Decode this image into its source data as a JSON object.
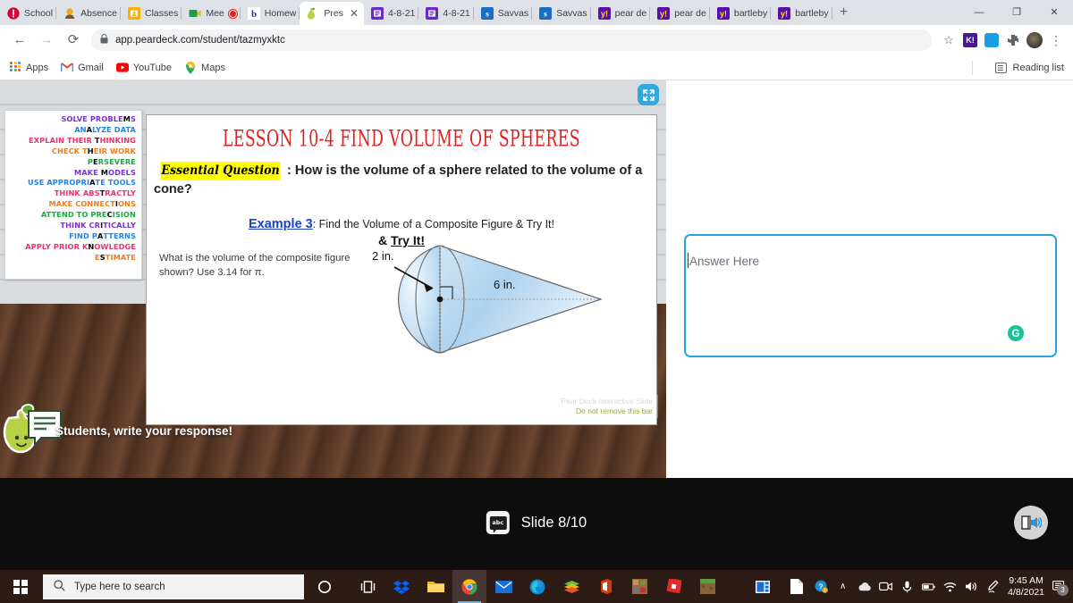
{
  "browser": {
    "tabs": [
      {
        "label": "School",
        "icon": "school-icon",
        "color": "#e8003c",
        "active": false
      },
      {
        "label": "Absence",
        "icon": "absence-icon",
        "color": "#f5a623",
        "active": false
      },
      {
        "label": "Classes",
        "icon": "classes-icon",
        "color": "#f5b300",
        "active": false
      },
      {
        "label": "Mee",
        "icon": "meet-icon",
        "color": "#1a9e4b",
        "active": false
      },
      {
        "label": "Homew",
        "icon": "bartleby-icon",
        "color": "#ffffff",
        "active": false
      },
      {
        "label": "Pres",
        "icon": "peardeck-icon",
        "color": "#ffffff",
        "active": true
      },
      {
        "label": "4-8-21",
        "icon": "slides-icon",
        "color": "#6a29c9",
        "active": false
      },
      {
        "label": "4-8-21",
        "icon": "slides-icon",
        "color": "#6a29c9",
        "active": false
      },
      {
        "label": "Savvas",
        "icon": "savvas-icon",
        "color": "#1a6fc4",
        "active": false
      },
      {
        "label": "Savvas",
        "icon": "savvas-icon",
        "color": "#1a6fc4",
        "active": false
      },
      {
        "label": "pear de",
        "icon": "pear-yellow-icon",
        "color": "#5a10a8",
        "active": false
      },
      {
        "label": "pear de",
        "icon": "pear-yellow-icon",
        "color": "#5a10a8",
        "active": false
      },
      {
        "label": "bartleby",
        "icon": "pear-yellow-icon",
        "color": "#5a10a8",
        "active": false
      },
      {
        "label": "bartleby",
        "icon": "pear-yellow-icon",
        "color": "#5a10a8",
        "active": false
      }
    ],
    "new_tab_label": "+",
    "close_tab_label": "✕",
    "window": {
      "minimize": "—",
      "maximize": "❐",
      "close": "✕"
    },
    "nav": {
      "back": "←",
      "forward": "→",
      "reload": "⟳"
    },
    "url": "app.peardeck.com/student/tazmyxktc",
    "lock_label": "🔒",
    "star_label": "☆",
    "extensions": [
      {
        "name": "kahoot-extension",
        "label": "K!"
      },
      {
        "name": "blue-extension",
        "label": ""
      },
      {
        "name": "puzzle-extension",
        "label": "🧩"
      }
    ],
    "menu_label": "⋮",
    "bookmarks": [
      {
        "label": "Apps",
        "icon": "apps-grid-icon"
      },
      {
        "label": "Gmail",
        "icon": "gmail-icon"
      },
      {
        "label": "YouTube",
        "icon": "youtube-icon"
      },
      {
        "label": "Maps",
        "icon": "maps-pin-icon"
      }
    ],
    "reading_list": "Reading list"
  },
  "poster": {
    "title": "MATHEMATICIANS",
    "lines": [
      {
        "pre": "SOLVE PROBLE",
        "letter": "M",
        "post": "S",
        "color": "#7b2fd6"
      },
      {
        "pre": "AN",
        "letter": "A",
        "post": "LYZE DATA",
        "color": "#1f84e8"
      },
      {
        "pre": "EXPLAIN THEIR ",
        "letter": "T",
        "post": "HINKING",
        "color": "#e8326b"
      },
      {
        "pre": "CHECK T",
        "letter": "H",
        "post": "EIR WORK",
        "color": "#f07d1a"
      },
      {
        "pre": "P",
        "letter": "E",
        "post": "RSEVERE",
        "color": "#19a844"
      },
      {
        "pre": "MAKE ",
        "letter": "M",
        "post": "ODELS",
        "color": "#7b2fd6"
      },
      {
        "pre": "USE APPROPRI",
        "letter": "A",
        "post": "TE TOOLS",
        "color": "#1f84e8"
      },
      {
        "pre": "THINK ABS",
        "letter": "T",
        "post": "RACTLY",
        "color": "#e8326b"
      },
      {
        "pre": "MAKE CONNECT",
        "letter": "I",
        "post": "ONS",
        "color": "#f07d1a"
      },
      {
        "pre": "ATTEND TO PRE",
        "letter": "C",
        "post": "ISION",
        "color": "#19a844"
      },
      {
        "pre": "THINK CR",
        "letter": "I",
        "post": "TICALLY",
        "color": "#7b2fd6"
      },
      {
        "pre": "FIND P",
        "letter": "A",
        "post": "TTERNS",
        "color": "#1f84e8"
      },
      {
        "pre": "APPLY PRIOR K",
        "letter": "N",
        "post": "OWLEDGE",
        "color": "#e8326b"
      },
      {
        "pre": "E",
        "letter": "S",
        "post": "TIMATE",
        "color": "#f07d1a"
      }
    ]
  },
  "slide": {
    "title": "LESSON 10-4 FIND VOLUME OF SPHERES",
    "essential_question_tag": "Essential Question",
    "essential_question_text": ": How is the volume of a sphere related to the volume of a cone?",
    "example_link": "Example 3",
    "example_text": ": Find the Volume of a Composite Figure & Try It!",
    "try_it_prefix": "& ",
    "try_it": "Try It!",
    "question": "What is the volume of the composite figure shown? Use 3.14 for π.",
    "figure": {
      "label_radius": "2 in.",
      "label_height": "6 in.",
      "shape": "hemisphere-and-cone"
    },
    "expand_button": "expand-slide",
    "footer_prompt": "Students, write your response!",
    "pd_bar_line1": "Pear Deck Interactive Slide",
    "pd_bar_line2": "Do not remove this bar"
  },
  "answer": {
    "placeholder": "Answer Here",
    "value": "",
    "grammarly_label": "G"
  },
  "controlbar": {
    "slide_counter": "Slide 8/10",
    "abc_icon_label": "abc",
    "reader_button": "immersive-reader-button"
  },
  "taskbar": {
    "search_placeholder": "Type here to search",
    "start_label": "start-button",
    "cortana_label": "cortana-button",
    "apps": [
      {
        "name": "task-view-icon",
        "label": ""
      },
      {
        "name": "dropbox-icon",
        "label": ""
      },
      {
        "name": "file-explorer-icon",
        "label": ""
      },
      {
        "name": "chrome-icon",
        "label": ""
      },
      {
        "name": "mail-icon",
        "label": ""
      },
      {
        "name": "edge-icon",
        "label": ""
      },
      {
        "name": "seesaw-icon",
        "label": ""
      },
      {
        "name": "office-icon",
        "label": ""
      },
      {
        "name": "minecraft-build-icon",
        "label": ""
      },
      {
        "name": "roblox-icon",
        "label": ""
      },
      {
        "name": "minecraft-icon",
        "label": ""
      },
      {
        "name": "media-player-icon",
        "label": ""
      },
      {
        "name": "document-icon",
        "label": ""
      }
    ],
    "tray": {
      "help_icon": "?",
      "chevron": "∧",
      "onedrive": "☁",
      "camera": "⦿",
      "mic": "🎙",
      "battery": "▭",
      "wifi": "◠",
      "volume": "🔊",
      "pen": "✎",
      "time": "9:45 AM",
      "date": "4/8/2021",
      "notification_count": "3"
    }
  }
}
